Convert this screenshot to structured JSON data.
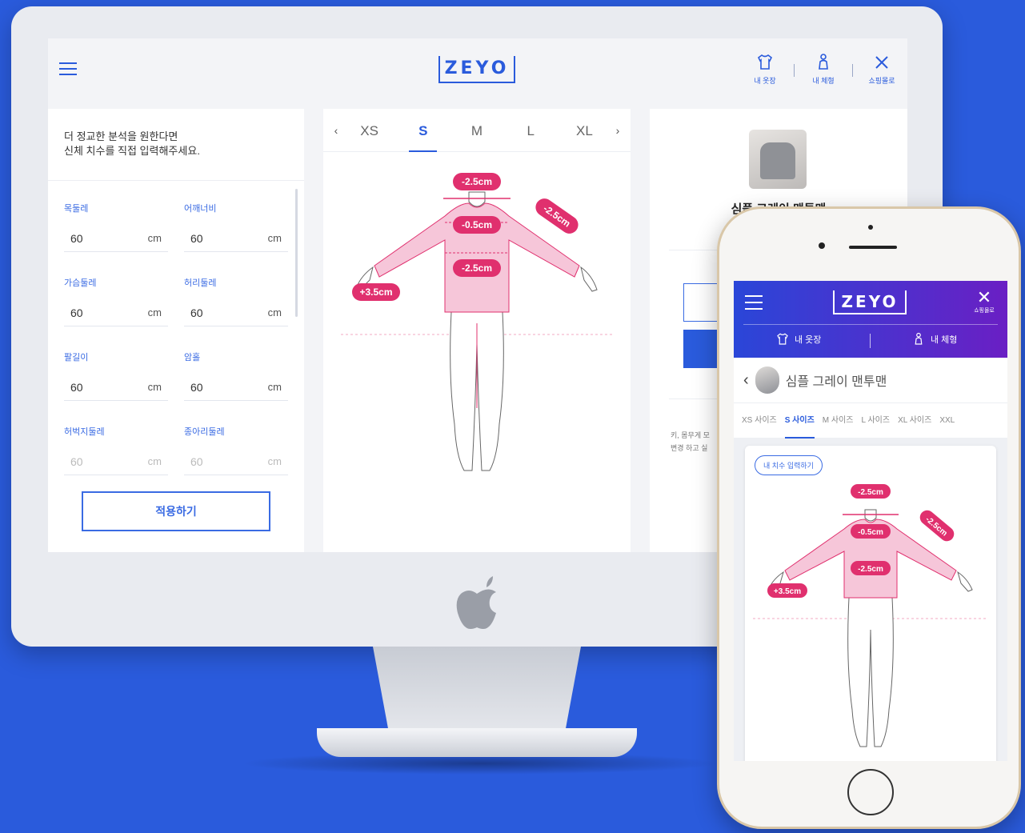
{
  "desktop": {
    "brand": "ZEYO",
    "header_actions": [
      {
        "label": "내 옷장",
        "icon": "shirt-icon"
      },
      {
        "label": "내 체형",
        "icon": "body-icon"
      },
      {
        "label": "쇼핑몰로",
        "icon": "close-icon"
      }
    ],
    "form": {
      "intro_line1": "더 정교한 분석을 원한다면",
      "intro_line2": "신체 치수를 직접 입력해주세요.",
      "fields": [
        {
          "label": "목둘레",
          "value": "60",
          "unit": "cm"
        },
        {
          "label": "어깨너비",
          "value": "60",
          "unit": "cm"
        },
        {
          "label": "가슴둘레",
          "value": "60",
          "unit": "cm"
        },
        {
          "label": "허리둘레",
          "value": "60",
          "unit": "cm"
        },
        {
          "label": "팔길이",
          "value": "60",
          "unit": "cm"
        },
        {
          "label": "암홀",
          "value": "60",
          "unit": "cm"
        },
        {
          "label": "허벅지둘레",
          "value": "60",
          "unit": "cm"
        },
        {
          "label": "종아리둘레",
          "value": "60",
          "unit": "cm"
        }
      ],
      "apply_label": "적용하기"
    },
    "size_tabs": {
      "prev": "‹",
      "next": "›",
      "items": [
        "XS",
        "S",
        "M",
        "L",
        "XL"
      ],
      "active": "S"
    },
    "fit_badges": {
      "neck": "-2.5cm",
      "sleeve": "-2.5cm",
      "shoulder": "-0.5cm",
      "chest": "-2.5cm",
      "arm": "+3.5cm"
    },
    "product": {
      "name": "심플 그레이 맨투맨",
      "note_line1": "키, 몸무게 모",
      "note_line2": "변경 하고 실"
    }
  },
  "mobile": {
    "brand": "ZEYO",
    "close_label": "쇼핑몰로",
    "tabs": [
      {
        "label": "내 옷장",
        "icon": "shirt-icon"
      },
      {
        "label": "내 체형",
        "icon": "body-icon"
      }
    ],
    "product_name": "심플 그레이 맨투맨",
    "sizes": [
      "XS 사이즈",
      "S 사이즈",
      "M 사이즈",
      "L 사이즈",
      "XL 사이즈",
      "XXL"
    ],
    "active_size": "S 사이즈",
    "input_button": "내 치수 입력하기",
    "fit_badges": {
      "neck": "-2.5cm",
      "sleeve": "-2.5cm",
      "shoulder": "-0.5cm",
      "chest": "-2.5cm",
      "arm": "+3.5cm"
    }
  },
  "colors": {
    "background": "#2a5bdc",
    "accent": "#2a5bdc",
    "badge": "#e0306e",
    "garment": "#f6c6d9",
    "mobile_header_start": "#2a46d8",
    "mobile_header_end": "#6a1fc4"
  }
}
